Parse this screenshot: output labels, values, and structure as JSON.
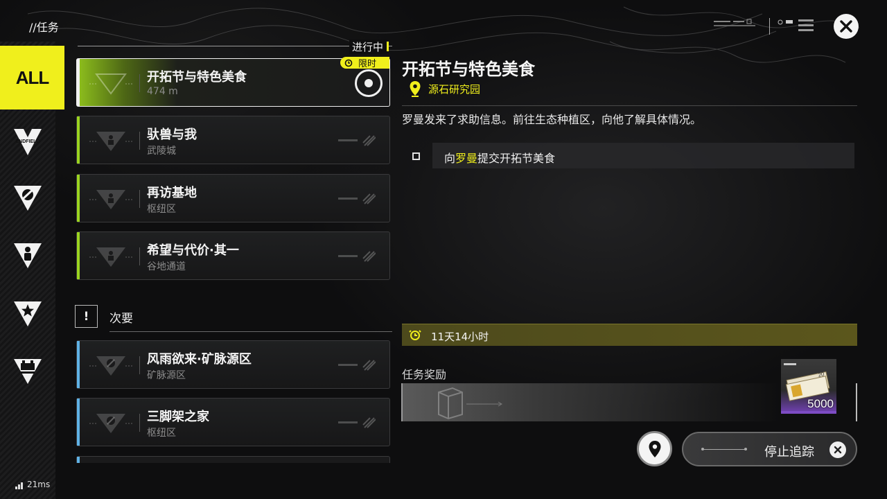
{
  "header": {
    "breadcrumb": "//任务"
  },
  "rail": {
    "items": [
      {
        "name": "all",
        "label": "ALL",
        "active": true
      },
      {
        "name": "endfield",
        "label": "ENDFIELD",
        "icon": "endfield-logo-icon"
      },
      {
        "name": "exploration",
        "icon": "no-entry-icon"
      },
      {
        "name": "character",
        "icon": "person-icon"
      },
      {
        "name": "favorite",
        "icon": "star-icon"
      },
      {
        "name": "facility",
        "icon": "building-icon"
      }
    ]
  },
  "missions": {
    "ongoing_label": "进行中",
    "limited_label": "限时",
    "main": [
      {
        "title": "开拓节与特色美食",
        "sub": "474 m",
        "selected": true,
        "stripe": "#9bd420"
      },
      {
        "title": "驮兽与我",
        "sub": "武陵城",
        "stripe": "#9bd420"
      },
      {
        "title": "再访基地",
        "sub": "枢纽区",
        "stripe": "#9bd420"
      },
      {
        "title": "希望与代价·其一",
        "sub": "谷地通道",
        "stripe": "#9bd420"
      }
    ],
    "secondary_label": "次要",
    "secondary_icon_text": "!",
    "secondary": [
      {
        "title": "风雨欲来·矿脉源区",
        "sub": "矿脉源区",
        "stripe": "#5fb2e6"
      },
      {
        "title": "三脚架之家",
        "sub": "枢纽区",
        "stripe": "#5fb2e6"
      }
    ]
  },
  "detail": {
    "title": "开拓节与特色美食",
    "location": "源石研究园",
    "description": "罗曼发来了求助信息。前往生态种植区，向他了解具体情况。",
    "objective": {
      "pre": "向",
      "highlight": "罗曼",
      "post": "提交开拓节美食"
    },
    "time_left": "11天14小时",
    "reward_label": "任务奖励",
    "reward_quantity": "5000"
  },
  "actions": {
    "stop_tracking": "停止追踪"
  },
  "status": {
    "ping": "21ms"
  },
  "colors": {
    "accent": "#f0ef1c",
    "main_stripe": "#9bd420",
    "secondary_stripe": "#5fb2e6",
    "reward_rarity": "#7d4cc4"
  }
}
